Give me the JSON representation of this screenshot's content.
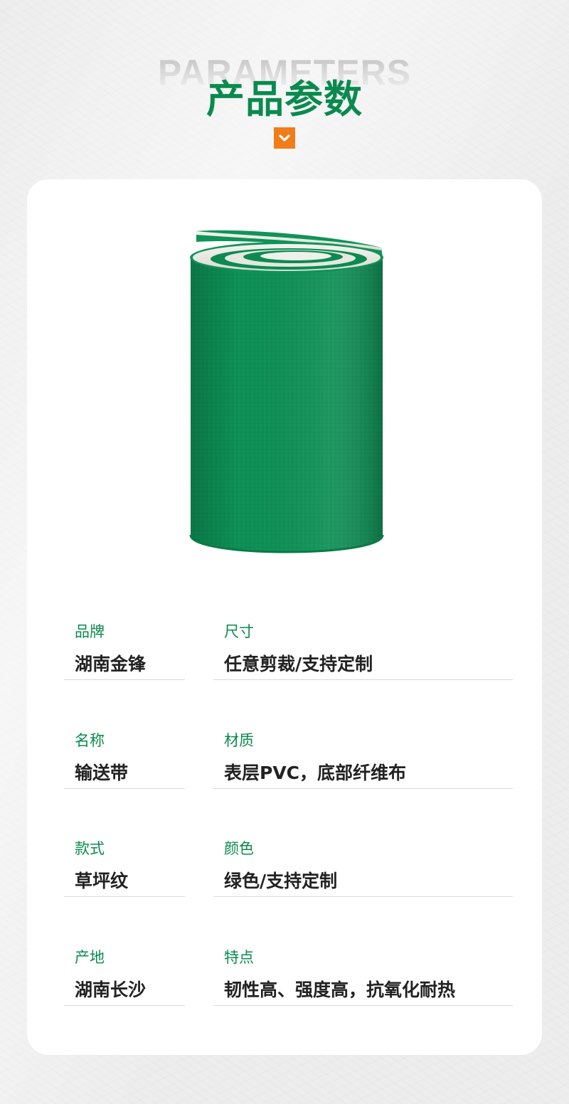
{
  "header": {
    "title_en": "PARAMETERS",
    "title_cn": "产品参数",
    "chevron_icon": "chevron-down-icon",
    "accent_color": "#f07d1a",
    "brand_color": "#0a8a4e"
  },
  "product": {
    "image_subject": "green-pvc-conveyor-belt-roll",
    "belt_color": "#0f9358"
  },
  "params": [
    {
      "label": "品牌",
      "value": "湖南金锋"
    },
    {
      "label": "尺寸",
      "value": "任意剪裁/支持定制"
    },
    {
      "label": "名称",
      "value": "输送带"
    },
    {
      "label": "材质",
      "value": "表层PVC，底部纤维布"
    },
    {
      "label": "款式",
      "value": "草坪纹"
    },
    {
      "label": "颜色",
      "value": "绿色/支持定制"
    },
    {
      "label": "产地",
      "value": "湖南长沙"
    },
    {
      "label": "特点",
      "value": "韧性高、强度高，抗氧化耐热"
    }
  ]
}
